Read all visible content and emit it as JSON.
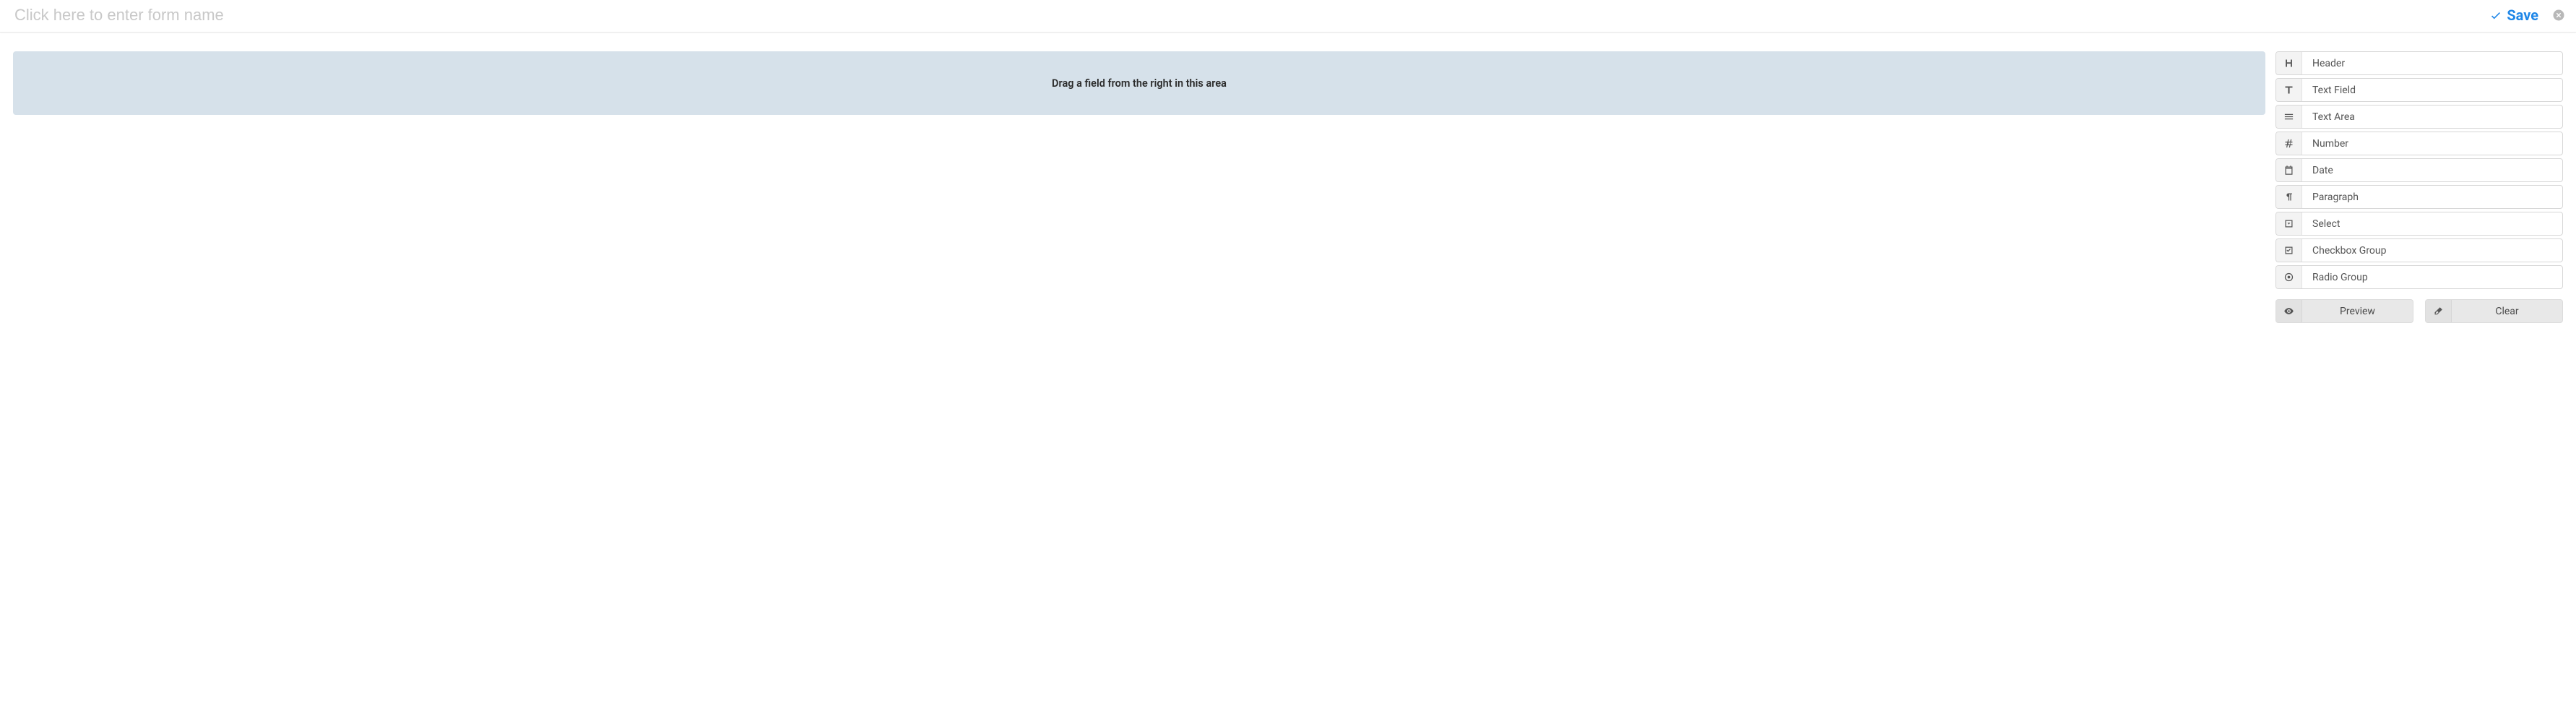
{
  "header": {
    "form_name_placeholder": "Click here to enter form name",
    "form_name_value": "",
    "save_label": "Save"
  },
  "canvas": {
    "empty_hint": "Drag a field from the right in this area"
  },
  "sidebar": {
    "fields": [
      {
        "icon": "header",
        "label": "Header"
      },
      {
        "icon": "text-field",
        "label": "Text Field"
      },
      {
        "icon": "text-area",
        "label": "Text Area"
      },
      {
        "icon": "number",
        "label": "Number"
      },
      {
        "icon": "date",
        "label": "Date"
      },
      {
        "icon": "paragraph",
        "label": "Paragraph"
      },
      {
        "icon": "select",
        "label": "Select"
      },
      {
        "icon": "checkbox-group",
        "label": "Checkbox Group"
      },
      {
        "icon": "radio-group",
        "label": "Radio Group"
      }
    ],
    "actions": {
      "preview_label": "Preview",
      "clear_label": "Clear"
    }
  }
}
